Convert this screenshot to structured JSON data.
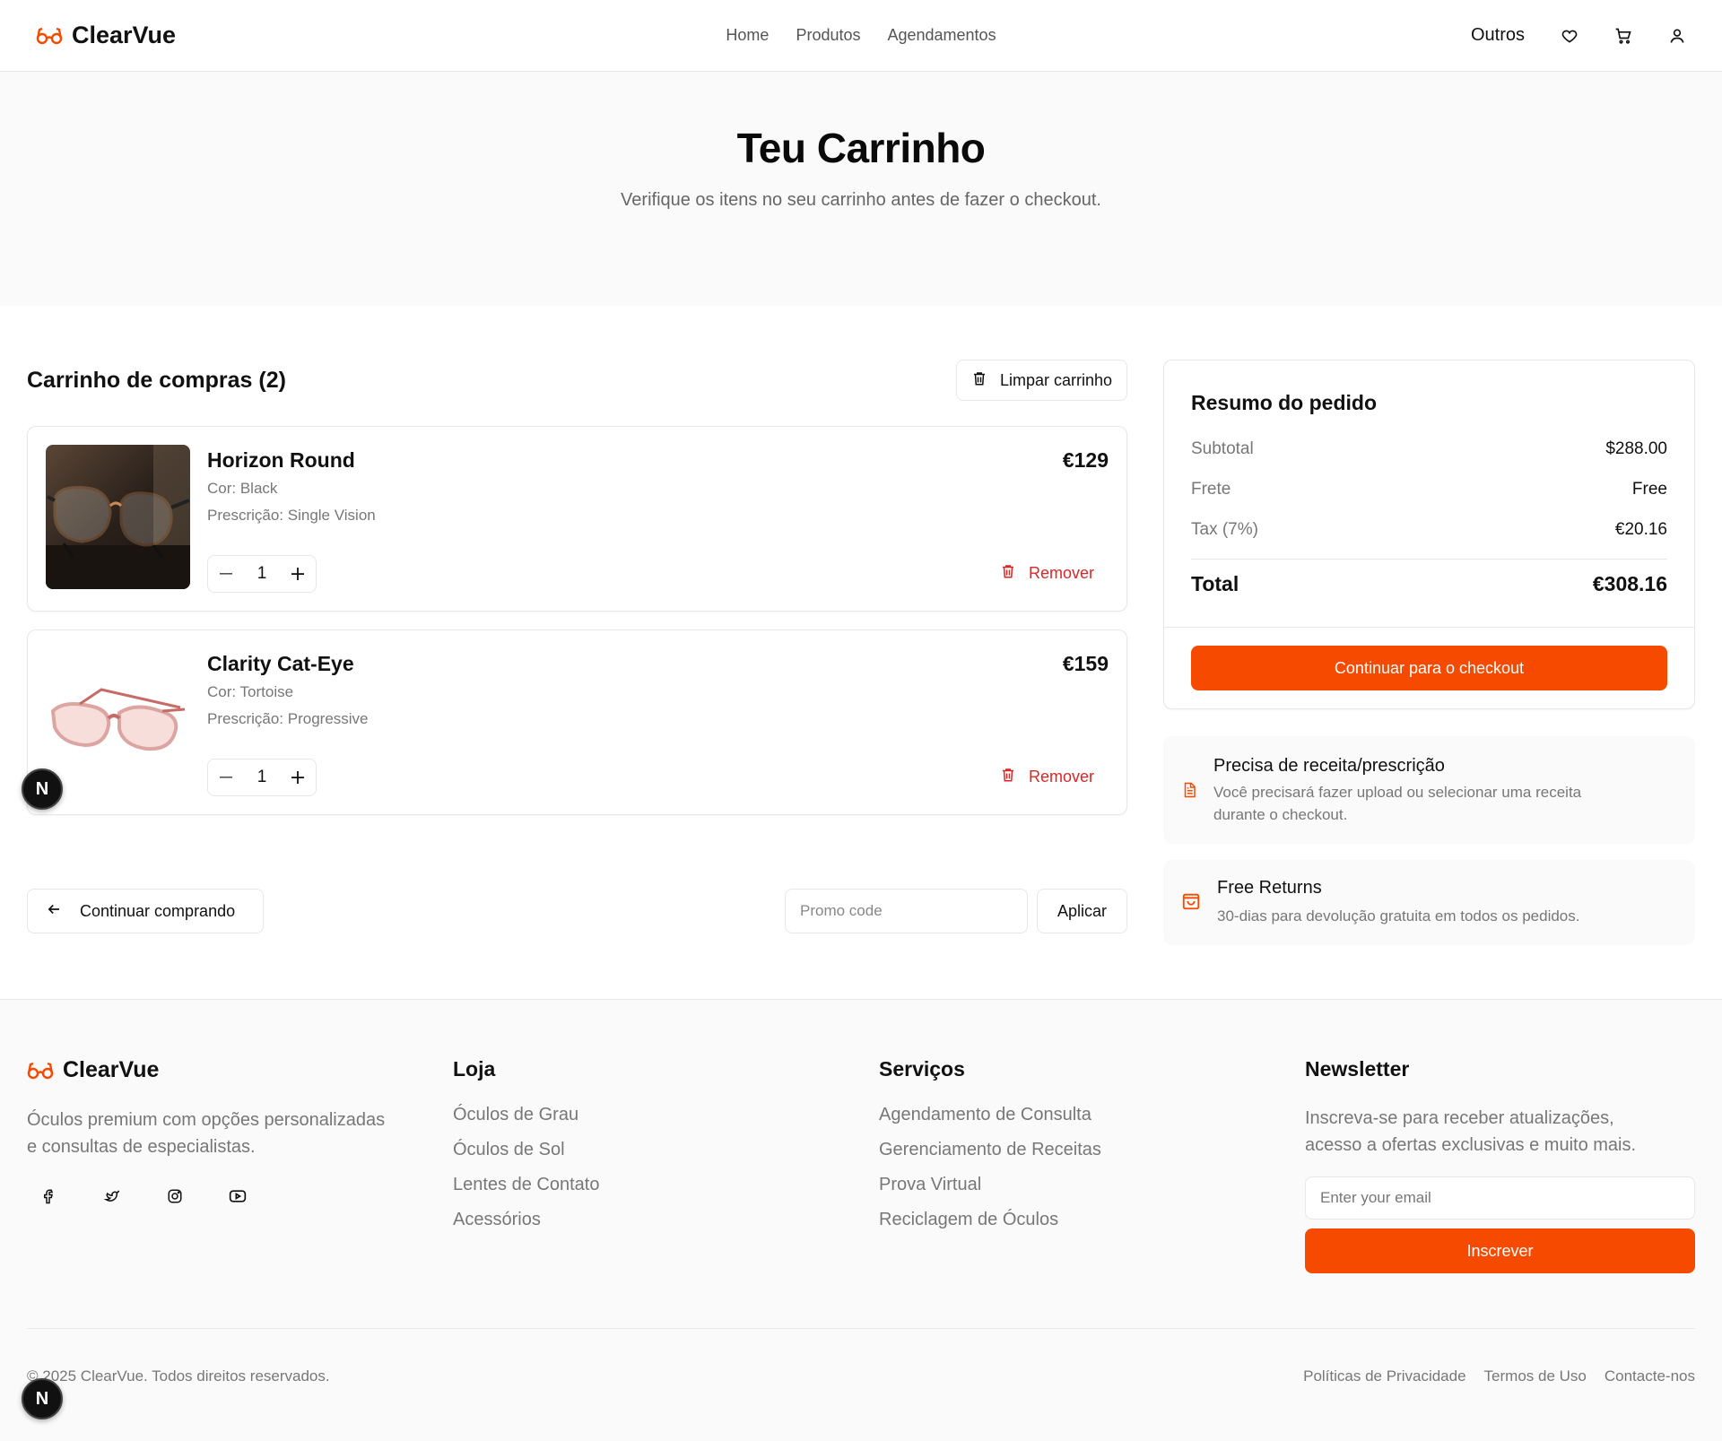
{
  "header": {
    "brand": "ClearVue",
    "nav": [
      "Home",
      "Produtos",
      "Agendamentos"
    ],
    "outros": "Outros"
  },
  "hero": {
    "title": "Teu Carrinho",
    "subtitle": "Verifique os itens no seu carrinho antes de fazer o checkout."
  },
  "cart": {
    "title": "Carrinho de compras (2)",
    "clear_label": "Limpar carrinho",
    "items": [
      {
        "name": "Horizon Round",
        "color": "Cor: Black",
        "prescription": "Prescrição: Single Vision",
        "price": "€129",
        "qty": "1",
        "remove": "Remover"
      },
      {
        "name": "Clarity Cat-Eye",
        "color": "Cor: Tortoise",
        "prescription": "Prescrição: Progressive",
        "price": "€159",
        "qty": "1",
        "remove": "Remover"
      }
    ],
    "continue_label": "Continuar comprando",
    "promo_placeholder": "Promo code",
    "apply_label": "Aplicar"
  },
  "summary": {
    "title": "Resumo do pedido",
    "rows": [
      {
        "label": "Subtotal",
        "value": "$288.00"
      },
      {
        "label": "Frete",
        "value": "Free"
      },
      {
        "label": "Tax (7%)",
        "value": "€20.16"
      }
    ],
    "total_label": "Total",
    "total_value": "€308.16",
    "checkout_label": "Continuar para o checkout"
  },
  "info": [
    {
      "title": "Precisa de receita/prescrição",
      "desc_line1": "Você precisará fazer upload ou selecionar uma receita",
      "desc_line2": "durante o checkout."
    },
    {
      "title": "Free Returns",
      "desc_line1": "30-dias para devolução gratuita em todos os pedidos."
    }
  ],
  "footer": {
    "brand": "ClearVue",
    "desc_line1": "Óculos premium com opções personalizadas",
    "desc_line2": "e consultas de especialistas.",
    "loja": {
      "title": "Loja",
      "links": [
        "Óculos de Grau",
        "Óculos de Sol",
        "Lentes de Contato",
        "Acessórios"
      ]
    },
    "servicos": {
      "title": "Serviços",
      "links": [
        "Agendamento de Consulta",
        "Gerenciamento de Receitas",
        "Prova Virtual",
        "Reciclagem de Óculos"
      ]
    },
    "newsletter": {
      "title": "Newsletter",
      "desc_line1": "Inscreva-se para receber atualizações,",
      "desc_line2": "acesso a ofertas exclusivas e muito mais.",
      "email_placeholder": "Enter your email",
      "subscribe_label": "Inscrever"
    },
    "copyright": "© 2025 ClearVue. Todos direitos reservados.",
    "legal": [
      "Políticas de Privacidade",
      "Termos de Uso",
      "Contacte-nos"
    ]
  },
  "dev_badge": "N",
  "colors": {
    "accent": "#f54a00",
    "danger": "#dc2626"
  }
}
